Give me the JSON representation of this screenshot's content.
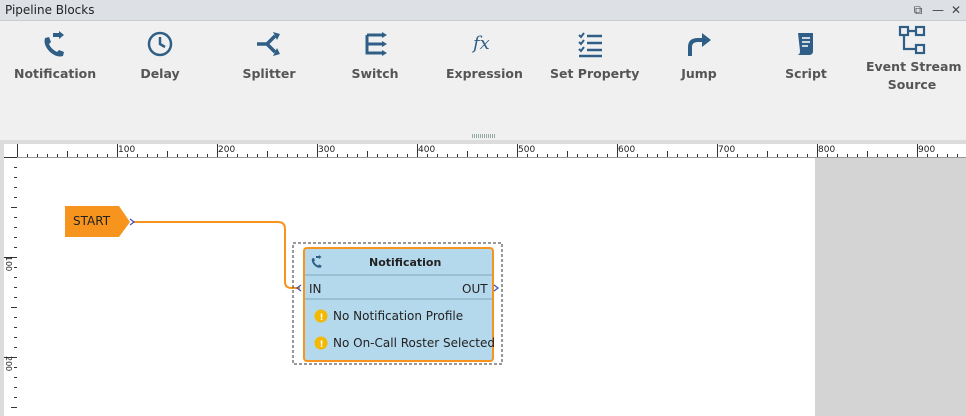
{
  "panel": {
    "title": "Pipeline Blocks"
  },
  "window_controls": {
    "restore": "⧉",
    "minimize": "—",
    "close": "✕"
  },
  "toolbar": {
    "items": [
      {
        "label": "Notification",
        "icon": "phone-forward-icon"
      },
      {
        "label": "Delay",
        "icon": "clock-icon"
      },
      {
        "label": "Splitter",
        "icon": "splitter-icon"
      },
      {
        "label": "Switch",
        "icon": "switch-icon"
      },
      {
        "label": "Expression",
        "icon": "function-icon"
      },
      {
        "label": "Set Property",
        "icon": "checklist-icon"
      },
      {
        "label": "Jump",
        "icon": "jump-arrow-icon"
      },
      {
        "label": "Script",
        "icon": "script-icon"
      },
      {
        "label": "Event Stream",
        "label2": "Source",
        "icon": "event-stream-icon"
      }
    ]
  },
  "ruler": {
    "h_labels": [
      "100",
      "200",
      "300",
      "400",
      "500",
      "600",
      "700",
      "800",
      "900"
    ],
    "v_labels": [
      "100",
      "200"
    ]
  },
  "canvas": {
    "start_label": "START",
    "block": {
      "title": "Notification",
      "in_label": "IN",
      "out_label": "OUT",
      "warnings": [
        "No Notification Profile",
        "No On-Call Roster Selected"
      ]
    }
  },
  "colors": {
    "accent_orange": "#f7941d",
    "icon_blue": "#2f5f86",
    "block_fill": "#b5d9ec",
    "warning_yellow": "#f3b800"
  }
}
